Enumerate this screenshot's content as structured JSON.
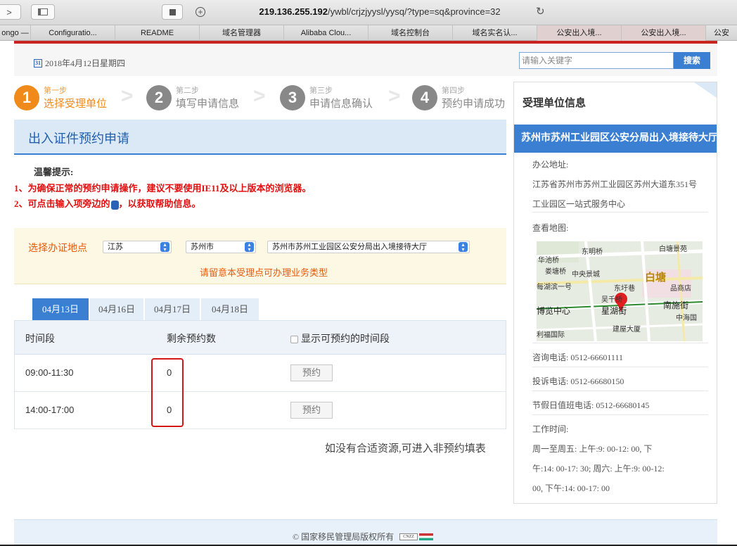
{
  "browser": {
    "url_host": "219.136.255.192",
    "url_path": "/ywbl/crjzjyysl/yysq/?type=sq&province=32",
    "bookmarks": [
      "ongo —",
      "Configuratio...",
      "README",
      "域名管理器",
      "Alibaba Clou...",
      "域名控制台",
      "域名实名认...",
      "公安出入境...",
      "公安出入境...",
      "公安"
    ]
  },
  "header": {
    "date": "2018年4月12日星期四",
    "search_placeholder": "请输入关键字",
    "search_button": "搜索"
  },
  "steps": [
    {
      "num": "1",
      "sub": "第一步",
      "label": "选择受理单位",
      "active": true
    },
    {
      "num": "2",
      "sub": "第二步",
      "label": "填写申请信息",
      "active": false
    },
    {
      "num": "3",
      "sub": "第三步",
      "label": "申请信息确认",
      "active": false
    },
    {
      "num": "4",
      "sub": "第四步",
      "label": "预约申请成功",
      "active": false
    }
  ],
  "main": {
    "title": "出入证件预约申请",
    "tips_heading": "温馨提示:",
    "tip1": "1、为确保正常的预约申请操作，建议不要使用IE11及以上版本的浏览器。",
    "tip2a": "2、可点击输入项旁边的",
    "tip2b": "，以获取帮助信息。",
    "location_label": "选择办证地点",
    "province": "江苏",
    "city": "苏州市",
    "office": "苏州市苏州工业园区公安分局出入境接待大厅",
    "location_note": "请留意本受理点可办理业务类型",
    "date_tabs": [
      "04月13日",
      "04月16日",
      "04月17日",
      "04月18日"
    ],
    "table": {
      "col_period": "时间段",
      "col_remaining": "剩余预约数",
      "col_show": "显示可预约的时间段",
      "rows": [
        {
          "period": "09:00-11:30",
          "remaining": "0",
          "action": "预约"
        },
        {
          "period": "14:00-17:00",
          "remaining": "0",
          "action": "预约"
        }
      ]
    },
    "no_resource": "如没有合适资源,可进入非预约填表"
  },
  "right_panel": {
    "heading": "受理单位信息",
    "office_name": "苏州市苏州工业园区公安分局出入境接待大厅",
    "address_label": "办公地址:",
    "address_line1": "江苏省苏州市苏州工业园区苏州大道东351号",
    "address_line2": "工业园区一站式服务中心",
    "map_label": "查看地图:",
    "map_labels": [
      "东明桥",
      "白塘景苑",
      "华池桥",
      "娄塘桥",
      "中央景城",
      "白塘",
      "每湖滨一号",
      "东圩巷",
      "品商店",
      "吴千桥",
      "南施街",
      "博览中心",
      "星湖街",
      "中海国",
      "利福国际",
      "建屋大厦"
    ],
    "consult_phone": "咨询电话:  0512-66601111",
    "complaint_phone": "投诉电话:  0512-66680150",
    "holiday_phone": "节假日值班电话:  0512-66680145",
    "hours_label": "工作时间:",
    "hours_line1": "周一至周五: 上午:9: 00-12: 00, 下",
    "hours_line2": "午:14: 00-17: 30; 周六: 上午:9: 00-12:",
    "hours_line3": "00, 下午:14: 00-17: 00"
  },
  "footer": {
    "copyright": "© 国家移民管理局版权所有",
    "badge": "CNZZ"
  },
  "colors": {
    "accent": "#3a7fd1",
    "orange": "#f08a1b",
    "red": "#e01010",
    "highlight": "#d41616"
  }
}
